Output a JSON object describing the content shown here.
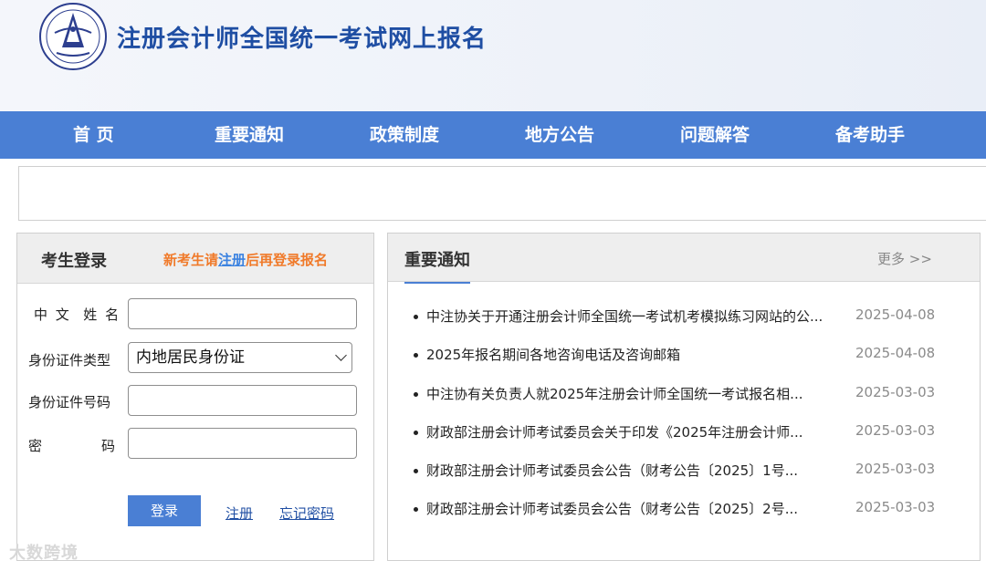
{
  "header": {
    "site_title": "注册会计师全国统一考试网上报名"
  },
  "nav": {
    "items": [
      "首 页",
      "重要通知",
      "政策制度",
      "地方公告",
      "问题解答",
      "备考助手"
    ]
  },
  "login": {
    "title": "考生登录",
    "hint_prefix": "新考生请",
    "hint_link": "注册",
    "hint_suffix": "后再登录报名",
    "name_label": "中 文  姓 名",
    "id_type_label": "身份证件类型",
    "id_type_value": "内地居民身份证",
    "id_number_label": "身份证件号码",
    "password_label_1": "密",
    "password_label_2": "码",
    "login_button": "登录",
    "register_link": "注册",
    "forgot_link": "忘记密码"
  },
  "notices": {
    "title": "重要通知",
    "more": "更多 >>",
    "items": [
      {
        "text": "中注协关于开通注册会计师全国统一考试机考模拟练习网站的公...",
        "date": "2025-04-08"
      },
      {
        "text": "2025年报名期间各地咨询电话及咨询邮箱",
        "date": "2025-04-08"
      },
      {
        "text": "中注协有关负责人就2025年注册会计师全国统一考试报名相...",
        "date": "2025-03-03"
      },
      {
        "text": "财政部注册会计师考试委员会关于印发《2025年注册会计师...",
        "date": "2025-03-03"
      },
      {
        "text": "财政部注册会计师考试委员会公告（财考公告〔2025〕1号...",
        "date": "2025-03-03"
      },
      {
        "text": "财政部注册会计师考试委员会公告（财考公告〔2025〕2号...",
        "date": "2025-03-03"
      }
    ]
  },
  "watermark": "大数跨境"
}
